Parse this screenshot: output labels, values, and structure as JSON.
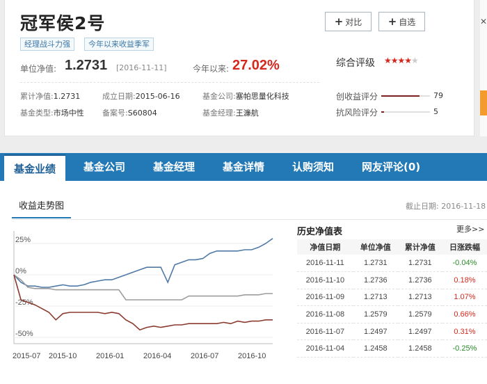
{
  "fund": {
    "name": "冠军侯2号",
    "tags": [
      "经理战斗力强",
      "今年以来收益季军"
    ],
    "nav_label": "单位净值:",
    "nav_value": "1.2731",
    "nav_date": "[2016-11-11]",
    "ytd_label": "今年以来:",
    "ytd_value": "27.02%",
    "cum_nav_label": "累计净值:",
    "cum_nav_value": "1.2731",
    "inception_label": "成立日期:",
    "inception_value": "2015-06-16",
    "company_label": "基金公司:",
    "company_value": "塞帕思量化科技",
    "type_label": "基金类型:",
    "type_value": "市场中性",
    "record_label": "备案号:",
    "record_value": "S60804",
    "manager_label": "基金经理:",
    "manager_value": "王濂航"
  },
  "actions": {
    "compare": "对比",
    "watch": "自选"
  },
  "rating": {
    "label": "综合评级",
    "stars_on": "★★★★",
    "stars_off": "★",
    "stars": 4,
    "return_label": "创收益评分",
    "return_score": "79",
    "risk_label": "抗风险评分",
    "risk_score": "5"
  },
  "tabs": [
    "基金业绩",
    "基金公司",
    "基金经理",
    "基金详情",
    "认购须知",
    "网友评论(0)"
  ],
  "subtab": "收益走势图",
  "as_of": "截止日期: 2016-11-18",
  "history": {
    "title": "历史净值表",
    "more": "更多>>",
    "headers": [
      "净值日期",
      "单位净值",
      "累计净值",
      "日涨跌幅"
    ],
    "rows": [
      [
        "2016-11-11",
        "1.2731",
        "1.2731",
        "-0.04%"
      ],
      [
        "2016-11-10",
        "1.2736",
        "1.2736",
        "0.18%"
      ],
      [
        "2016-11-09",
        "1.2713",
        "1.2713",
        "1.07%"
      ],
      [
        "2016-11-08",
        "1.2579",
        "1.2579",
        "0.66%"
      ],
      [
        "2016-11-07",
        "1.2497",
        "1.2497",
        "0.31%"
      ],
      [
        "2016-11-04",
        "1.2458",
        "1.2458",
        "-0.25%"
      ]
    ]
  },
  "colors": {
    "brand_blue": "#2379b6",
    "up_red": "#d6271d",
    "down_green": "#2a8a2a",
    "accent_orange": "#f39b2c"
  },
  "chart_data": {
    "type": "line",
    "x_ticks": [
      "2015-07",
      "2015-10",
      "2016-01",
      "2016-04",
      "2016-07",
      "2016-10"
    ],
    "y_ticks": [
      "25%",
      "0%",
      "-25%",
      "-50%"
    ],
    "ylim": [
      -55,
      35
    ],
    "series": [
      {
        "color": "#4f79a6",
        "values": [
          0,
          -6,
          -9,
          -9,
          -10,
          -10,
          -9,
          -8,
          -9,
          -9,
          -8,
          -6,
          -5,
          -4,
          -4,
          -2,
          0,
          2,
          4,
          6,
          6,
          6,
          -6,
          8,
          10,
          12,
          12,
          13,
          17,
          19,
          19,
          19,
          19,
          20,
          20,
          22,
          25,
          29
        ]
      },
      {
        "color": "#9c9c9c",
        "values": [
          0,
          -4,
          -10,
          -11,
          -11,
          -11,
          -12,
          -12,
          -12,
          -12,
          -12,
          -12,
          -12,
          -12,
          -12,
          -12,
          -20,
          -20,
          -20,
          -20,
          -20,
          -20,
          -20,
          -20,
          -20,
          -17,
          -17,
          -17,
          -17,
          -17,
          -17,
          -17,
          -17,
          -16,
          -16,
          -16,
          -15,
          -15
        ]
      },
      {
        "color": "#8a3a2e",
        "values": [
          0,
          -20,
          -22,
          -24,
          -27,
          -30,
          -36,
          -31,
          -30,
          -30,
          -30,
          -30,
          -30,
          -31,
          -30,
          -31,
          -36,
          -39,
          -44,
          -42,
          -41,
          -42,
          -41,
          -40,
          -40,
          -39,
          -39,
          -39,
          -39,
          -39,
          -38,
          -39,
          -37,
          -38,
          -37,
          -37,
          -36,
          -36
        ]
      }
    ]
  }
}
